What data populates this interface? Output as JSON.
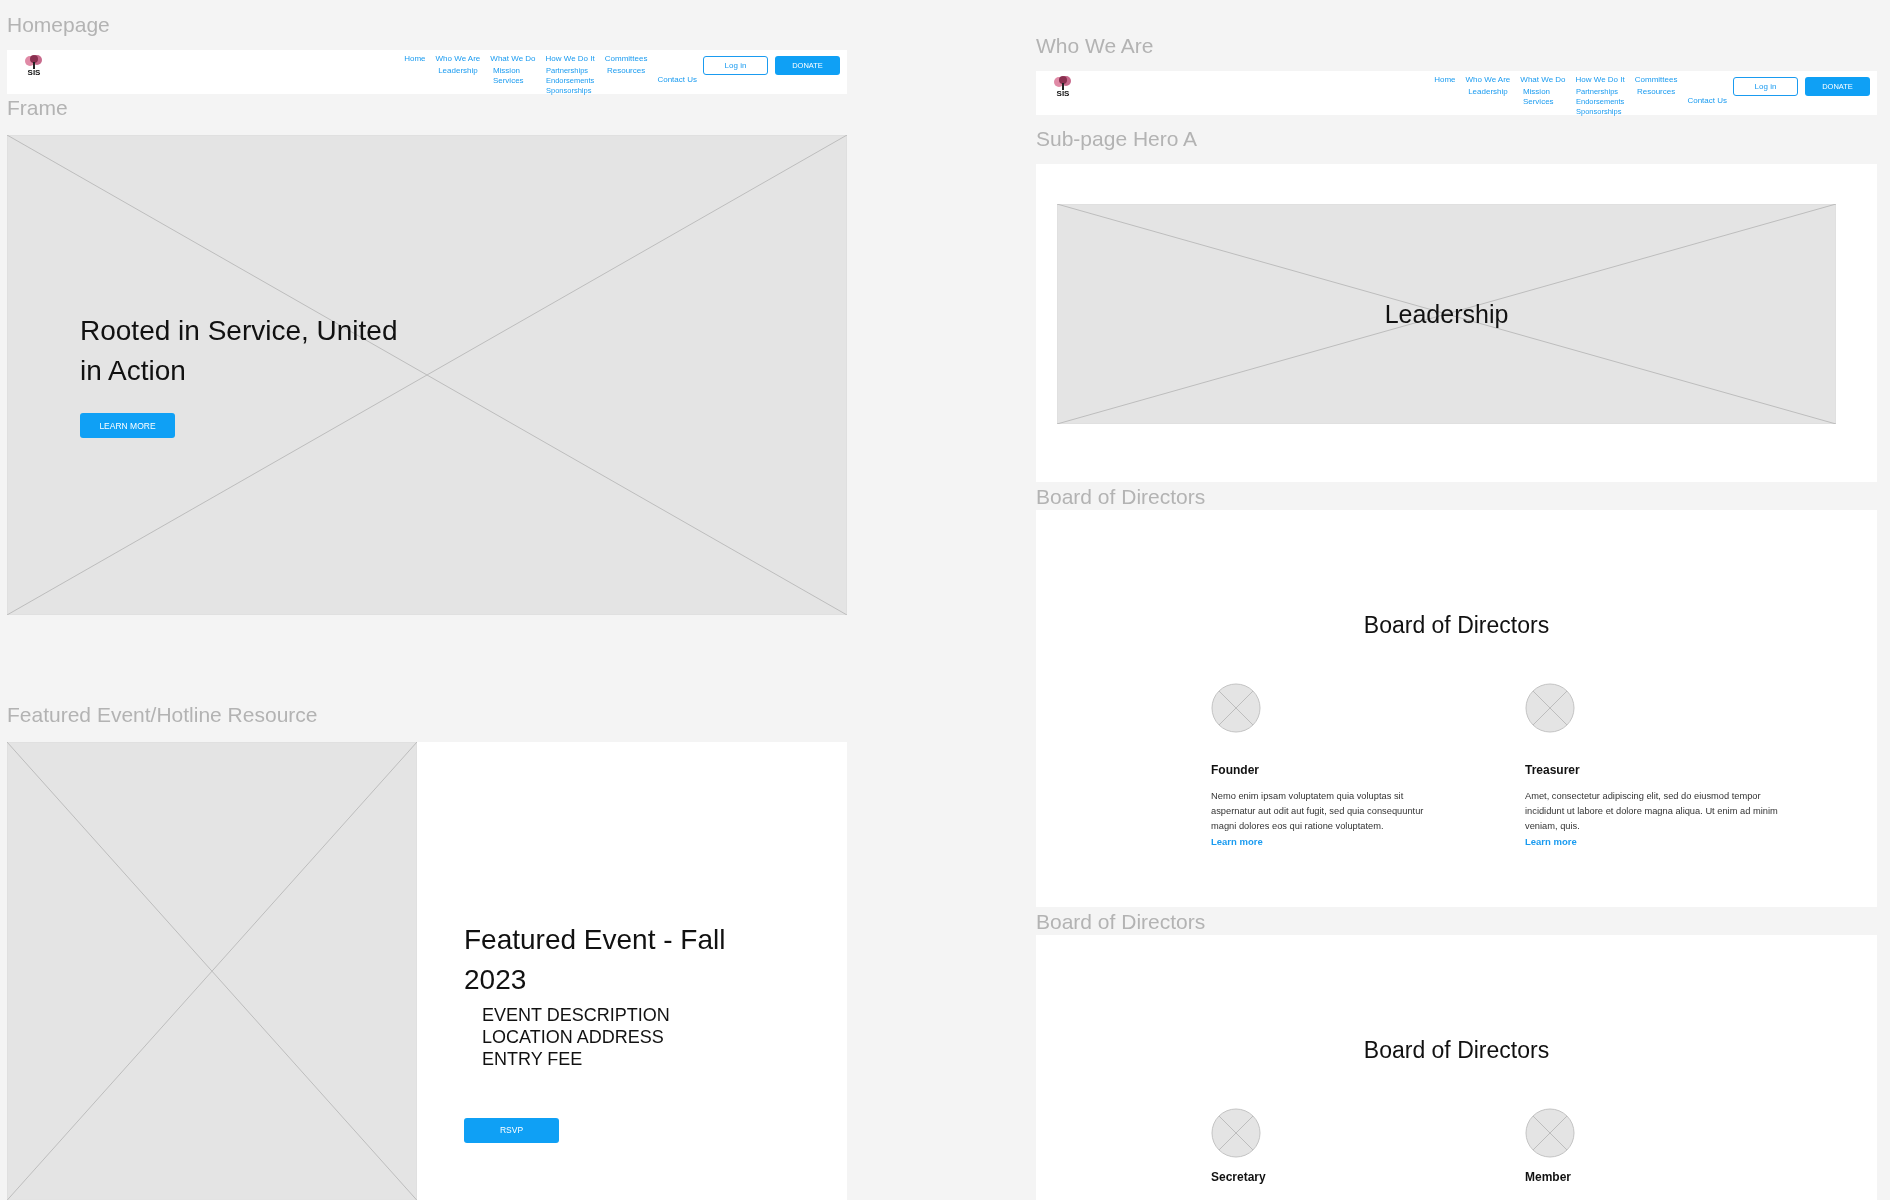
{
  "homepage": {
    "label": "Homepage",
    "navbar": {
      "logo_text": "SIS",
      "items": [
        {
          "label": "Home"
        },
        {
          "label": "Who We Are",
          "children": [
            "Leadership"
          ]
        },
        {
          "label": "What We Do",
          "children": [
            "Mission Services"
          ]
        },
        {
          "label": "How We Do It",
          "children": [
            "Partnerships",
            "Endorsements",
            "Sponsorships"
          ]
        },
        {
          "label": "Committees",
          "children": [
            "Resources"
          ]
        },
        {
          "label": "Contact Us"
        }
      ],
      "login": "Log in",
      "donate": "DONATE"
    },
    "hero": {
      "label": "Frame",
      "heading": "Rooted in Service, United in Action",
      "button": "LEARN MORE"
    },
    "featured": {
      "label": "Featured Event/Hotline Resource",
      "heading": "Featured Event - Fall 2023",
      "details": [
        "EVENT DESCRIPTION",
        "LOCATION ADDRESS",
        "ENTRY FEE"
      ],
      "button": "RSVP"
    }
  },
  "who_we_are": {
    "label": "Who We Are",
    "navbar": {
      "logo_text": "SIS",
      "items": [
        {
          "label": "Home"
        },
        {
          "label": "Who We Are",
          "children": [
            "Leadership"
          ]
        },
        {
          "label": "What We Do",
          "children": [
            "Mission Services"
          ]
        },
        {
          "label": "How We Do It",
          "children": [
            "Partnerships",
            "Endorsements",
            "Sponsorships"
          ]
        },
        {
          "label": "Committees",
          "children": [
            "Resources"
          ]
        },
        {
          "label": "Contact Us"
        }
      ],
      "login": "Log in",
      "donate": "DONATE"
    },
    "hero": {
      "label": "Sub-page Hero A",
      "heading": "Leadership"
    },
    "boards": [
      {
        "label": "Board of Directors",
        "heading": "Board of Directors",
        "members": [
          {
            "role": "Founder",
            "bio": "Nemo enim ipsam voluptatem quia voluptas sit aspernatur aut odit aut fugit, sed quia consequuntur magni dolores eos qui ratione voluptatem.",
            "link": "Learn more"
          },
          {
            "role": "Treasurer",
            "bio": "Amet, consectetur adipiscing elit, sed do eiusmod tempor incididunt ut labore et dolore magna aliqua. Ut enim ad minim veniam, quis.",
            "link": "Learn more"
          }
        ]
      },
      {
        "label": "Board of Directors",
        "heading": "Board of Directors",
        "members": [
          {
            "role": "Secretary"
          },
          {
            "role": "Member"
          }
        ]
      }
    ]
  }
}
